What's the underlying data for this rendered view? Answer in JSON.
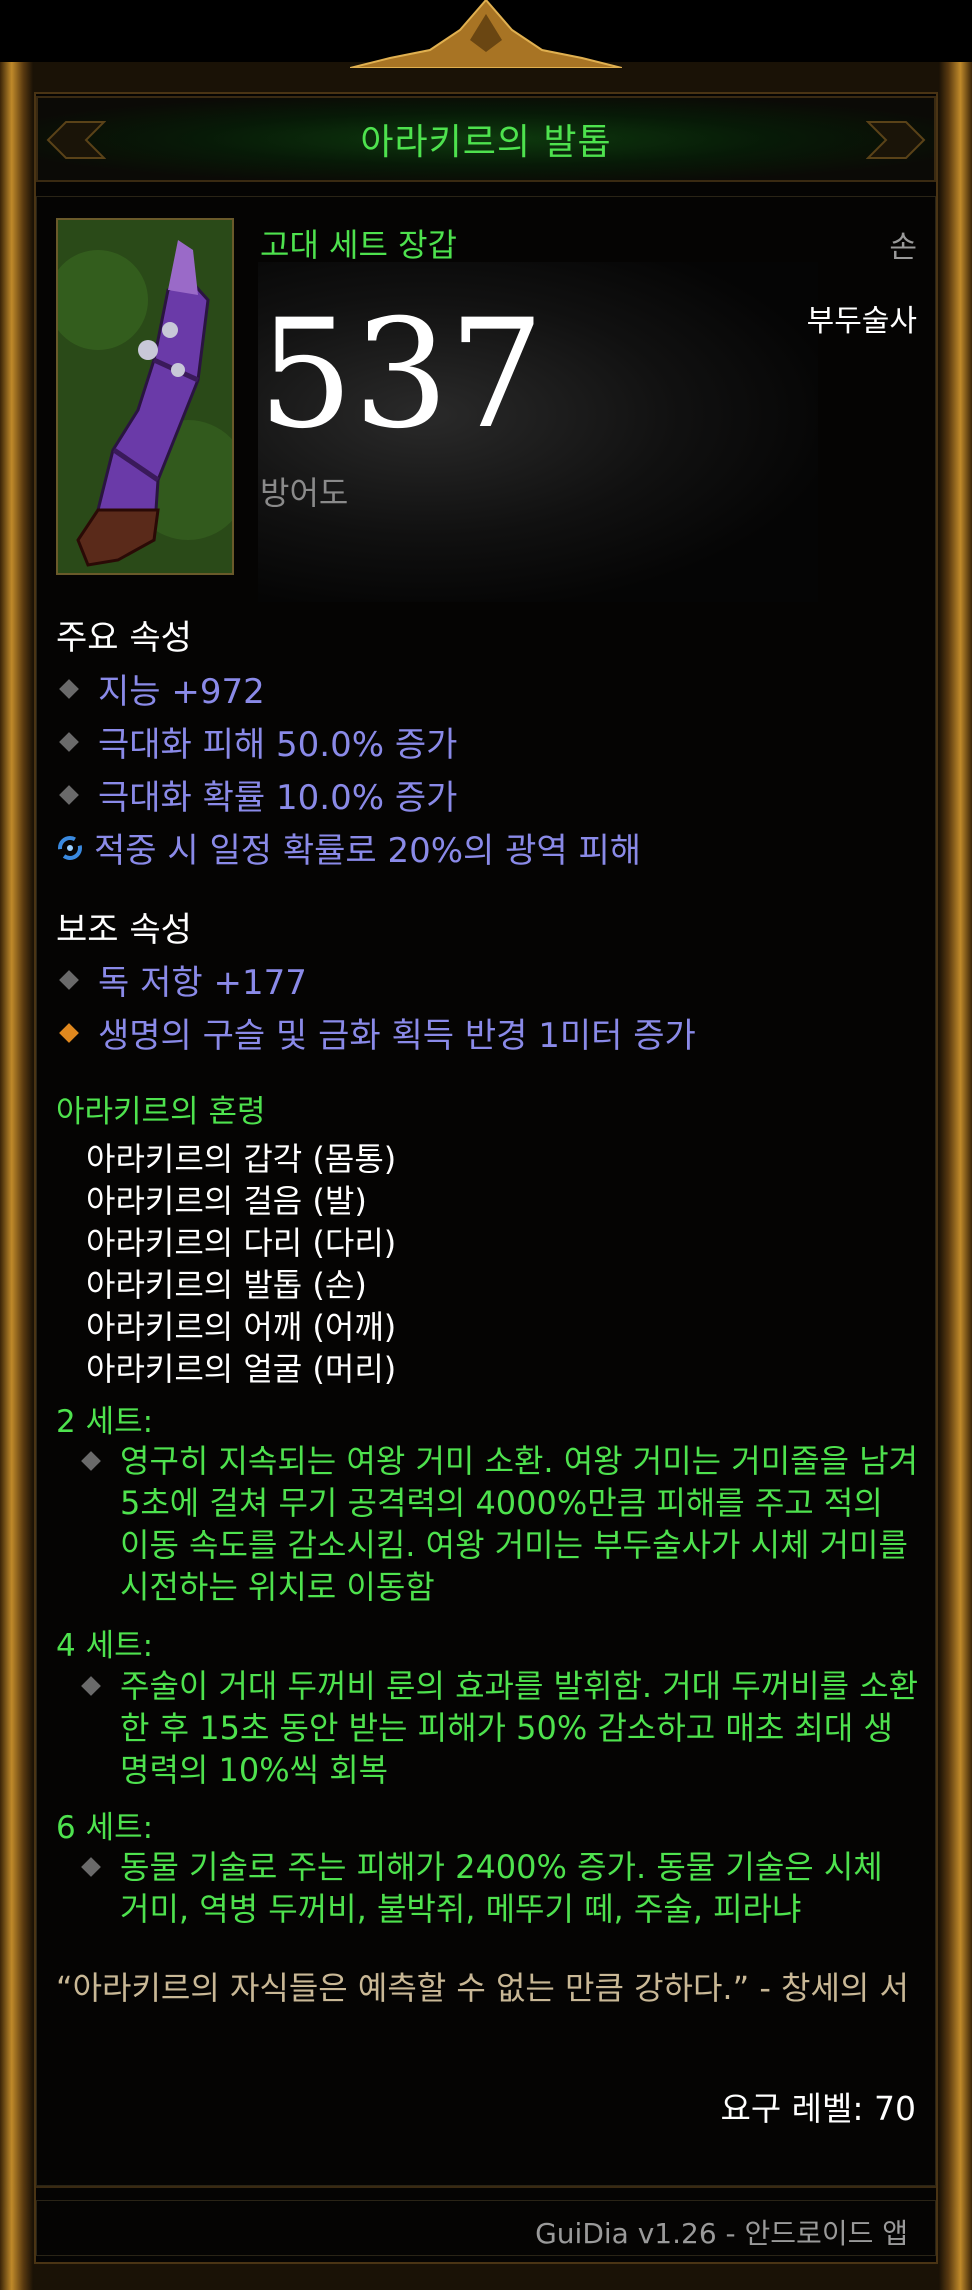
{
  "item": {
    "name": "아라키르의 발톱",
    "type": "고대 세트 장갑",
    "slot": "손",
    "class": "부두술사",
    "armor_value": "537",
    "armor_label": "방어도"
  },
  "primary": {
    "header": "주요 속성",
    "props": [
      "지능 +972",
      "극대화 피해 50.0% 증가",
      "극대화 확률 10.0% 증가",
      "적중 시 일정 확률로 20%의 광역 피해"
    ]
  },
  "secondary": {
    "header": "보조 속성",
    "props": [
      "독 저항 +177",
      "생명의 구슬 및 금화 획득 반경 1미터 증가"
    ]
  },
  "set": {
    "name": "아라키르의 혼령",
    "pieces": [
      "아라키르의 갑각 (몸통)",
      "아라키르의 걸음 (발)",
      "아라키르의 다리 (다리)",
      "아라키르의 발톱 (손)",
      "아라키르의 어깨 (어깨)",
      "아라키르의 얼굴 (머리)"
    ],
    "bonuses": [
      {
        "label": "2 세트:",
        "text": "영구히 지속되는 여왕 거미 소환. 여왕 거미는 거미줄을 남겨 5초에 걸쳐 무기 공격력의 4000%만큼 피해를 주고 적의 이동 속도를 감소시킴. 여왕 거미는 부두술사가 시체 거미를 시전하는 위치로 이동함"
      },
      {
        "label": "4 세트:",
        "text": "주술이 거대 두꺼비 룬의 효과를 발휘함. 거대 두꺼비를 소환한 후 15초 동안 받는 피해가 50% 감소하고 매초 최대 생명력의 10%씩 회복"
      },
      {
        "label": "6 세트:",
        "text": "동물 기술로 주는 피해가 2400% 증가. 동물 기술은 시체 거미, 역병 두꺼비, 불박쥐, 메뚜기 떼, 주술, 피라냐"
      }
    ]
  },
  "flavor": "“아라키르의 자식들은 예측할 수 없는 만큼 강하다.” - 창세의 서",
  "required_level": "요구 레벨: 70",
  "footer": "GuiDia v1.26 - 안드로이드 앱",
  "colors": {
    "set_green": "#4ee24e",
    "magic_blue": "#8a8ae8",
    "flavor_tan": "#c9b896"
  }
}
